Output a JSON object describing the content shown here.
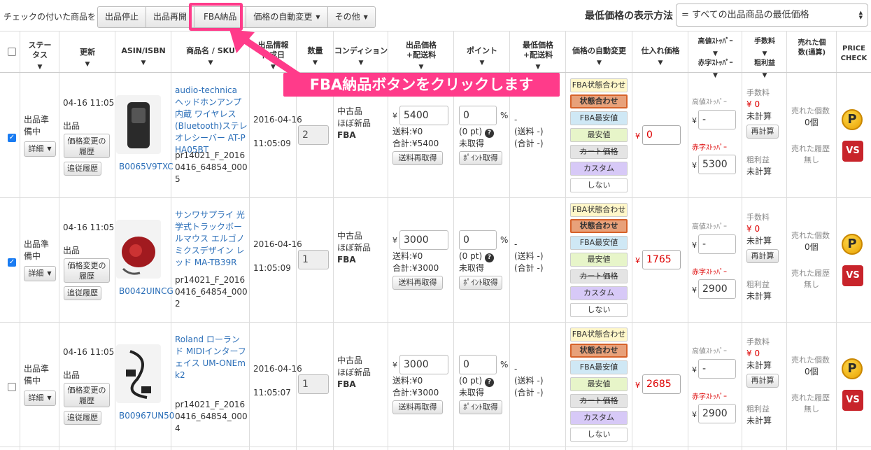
{
  "toolbar": {
    "label": "チェックの付いた商品を",
    "buttons": [
      "出品停止",
      "出品再開",
      "FBA納品",
      "価格の自動変更",
      "その他"
    ],
    "price_mode_label": "最低価格の表示方法",
    "price_mode_value": "= すべての出品商品の最低価格"
  },
  "annotation": {
    "text": "FBA納品ボタンをクリックします"
  },
  "headers": {
    "status": "ステータス",
    "updated": "更新",
    "asin": "ASIN/ISBN",
    "name": "商品名 / SKU",
    "created": "出品情報作成日",
    "qty": "数量",
    "condition": "コンディション",
    "price": "出品価格+配送料",
    "point": "ポイント",
    "lowest": "最低価格+配送料",
    "auto": "価格の自動変更",
    "cost": "仕入れ価格",
    "stopper": "高値ｽﾄｯﾊﾟｰ",
    "stopper2": "赤字ｽﾄｯﾊﾟｰ",
    "fee": "手数料",
    "fee2": "粗利益",
    "sold": "売れた個数(通算)",
    "pricecheck": "PRICE CHECK"
  },
  "common": {
    "status": "出品準備中",
    "detail": "詳細",
    "listed": "出品",
    "history": "価格変更の履歴",
    "follow": "追従履歴",
    "ship": "送料:¥0",
    "recalc_ship": "送料再取得",
    "point_pt": "(0 pt)",
    "not_acquired": "未取得",
    "point_btn": "ﾎﾟｲﾝﾄ取得",
    "lowest1": "-",
    "lowest2": "(送料 -)",
    "lowest3": "(合計 -)",
    "high_stopper": "高値ｽﾄｯﾊﾟｰ",
    "red_stopper": "赤字ｽﾄｯﾊﾟｰ",
    "fee_label": "手数料",
    "fee_value": "¥ 0",
    "uncalc": "未計算",
    "recalc": "再計算",
    "profit_label": "粗利益",
    "sold_label": "売れた個数",
    "sold_value": "0個",
    "sold_hist": "売れた履歴",
    "none": "無し",
    "yen": "¥",
    "percent": "%",
    "point_zero": "0",
    "high_stopper_value": "-",
    "cond1": "中古品",
    "cond2": "ほぼ新品",
    "cond3": "FBA",
    "chips": [
      "FBA状態合わせ",
      "状態合わせ",
      "FBA最安値",
      "最安値",
      "カート価格",
      "カスタム",
      "しない"
    ]
  },
  "rows": [
    {
      "updated": "04-16 11:05",
      "asin": "B0065V9TXC",
      "name": "audio-technica ヘッドホンアンプ内蔵 ワイヤレス (Bluetooth)ステレオレシーバー AT-PHA05BT",
      "sku": "pr14021_F_20160416_64854_0005",
      "created_date": "2016-04-16",
      "created_time": "11:05:09",
      "qty": "2",
      "price": "5400",
      "total": "合計:¥5400",
      "cost": "0",
      "red_stopper": "5300",
      "checked": true
    },
    {
      "updated": "04-16 11:05",
      "asin": "B0042UINCG",
      "name": "サンワサプライ 光学式トラックボールマウス エルゴノミクスデザイン レッド MA-TB39R",
      "sku": "pr14021_F_20160416_64854_0002",
      "created_date": "2016-04-16",
      "created_time": "11:05:09",
      "qty": "1",
      "price": "3000",
      "total": "合計:¥3000",
      "cost": "1765",
      "red_stopper": "2900",
      "checked": true
    },
    {
      "updated": "04-16 11:05",
      "asin": "B00967UN50",
      "name": "Roland ローランド MIDIインターフェイス UM-ONEmk2",
      "sku": "pr14021_F_20160416_64854_0004",
      "created_date": "2016-04-16",
      "created_time": "11:05:07",
      "qty": "1",
      "price": "3000",
      "total": "合計:¥3000",
      "cost": "2685",
      "red_stopper": "2900",
      "checked": false
    }
  ]
}
